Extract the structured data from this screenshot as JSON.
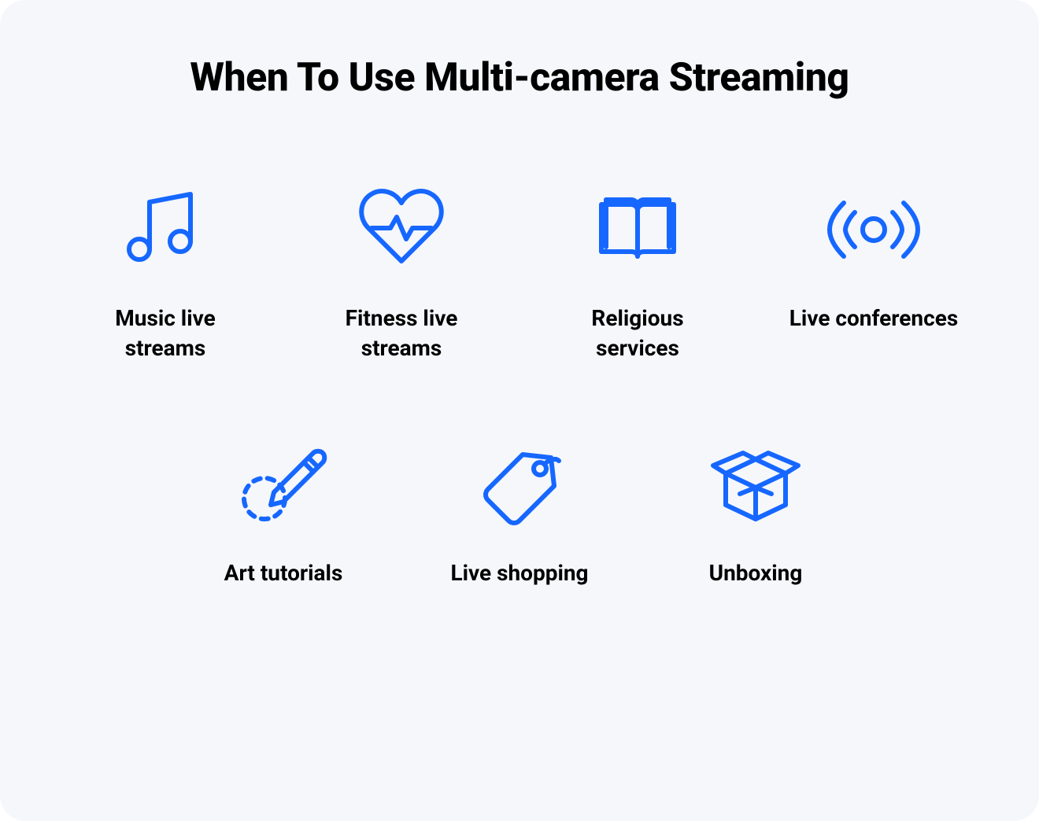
{
  "title": "When To Use Multi-camera Streaming",
  "icon_color": "#1667ff",
  "items": [
    {
      "label": "Music live streams",
      "icon": "music"
    },
    {
      "label": "Fitness live streams",
      "icon": "heart"
    },
    {
      "label": "Religious services",
      "icon": "book"
    },
    {
      "label": "Live conferences",
      "icon": "broadcast"
    },
    {
      "label": "Art tutorials",
      "icon": "pencil"
    },
    {
      "label": "Live shopping",
      "icon": "tag"
    },
    {
      "label": "Unboxing",
      "icon": "openbox"
    }
  ]
}
